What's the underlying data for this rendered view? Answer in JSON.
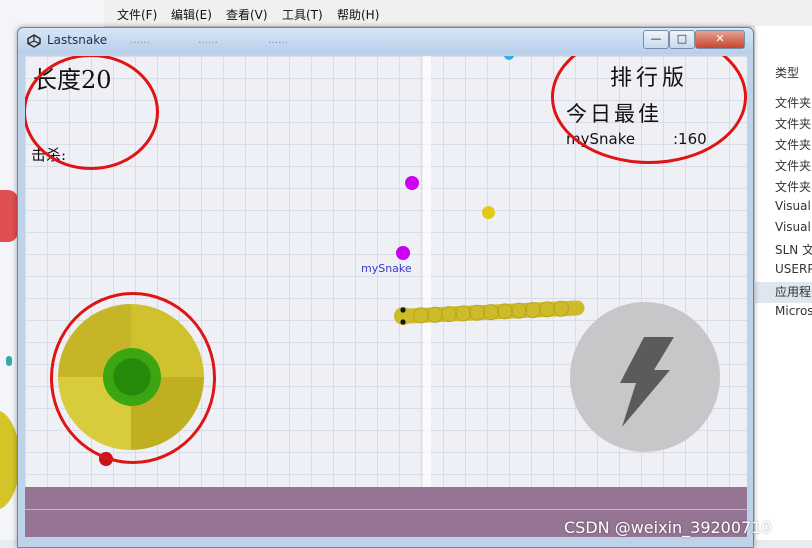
{
  "background_window": {
    "menu": [
      "文件(F)",
      "编辑(E)",
      "查看(V)",
      "工具(T)",
      "帮助(H)"
    ],
    "column_header": "类型",
    "rows": [
      "文件夹",
      "文件夹",
      "文件夹",
      "文件夹",
      "文件夹",
      "Visual",
      "Visual",
      "SLN 文",
      "USERP",
      "应用程",
      "Micros"
    ]
  },
  "game_window": {
    "title": "Lastsnake",
    "faint_toolbar": [
      "……",
      "……",
      "……"
    ],
    "controls": {
      "minimize": "—",
      "maximize": "□",
      "close": "✕"
    }
  },
  "hud": {
    "length_label": "长度20",
    "kills_label": "击杀:",
    "leaderboard_title": "排行版",
    "best_today_label": "今日最佳",
    "top_scores": [
      {
        "name": "mySnake",
        "score": ":160"
      }
    ]
  },
  "snake": {
    "name": "mySnake",
    "color": "#cdbb2a"
  },
  "food": [
    {
      "color": "#cc00ee"
    },
    {
      "color": "#e2c81a"
    },
    {
      "color": "#cc00ee"
    },
    {
      "color": "#2bb3e8"
    }
  ],
  "controls": {
    "joystick_color": "#d0c22e",
    "joystick_knob_color": "#3aa612",
    "boost_icon": "lightning-icon"
  },
  "watermark": "CSDN @weixin_39200710"
}
